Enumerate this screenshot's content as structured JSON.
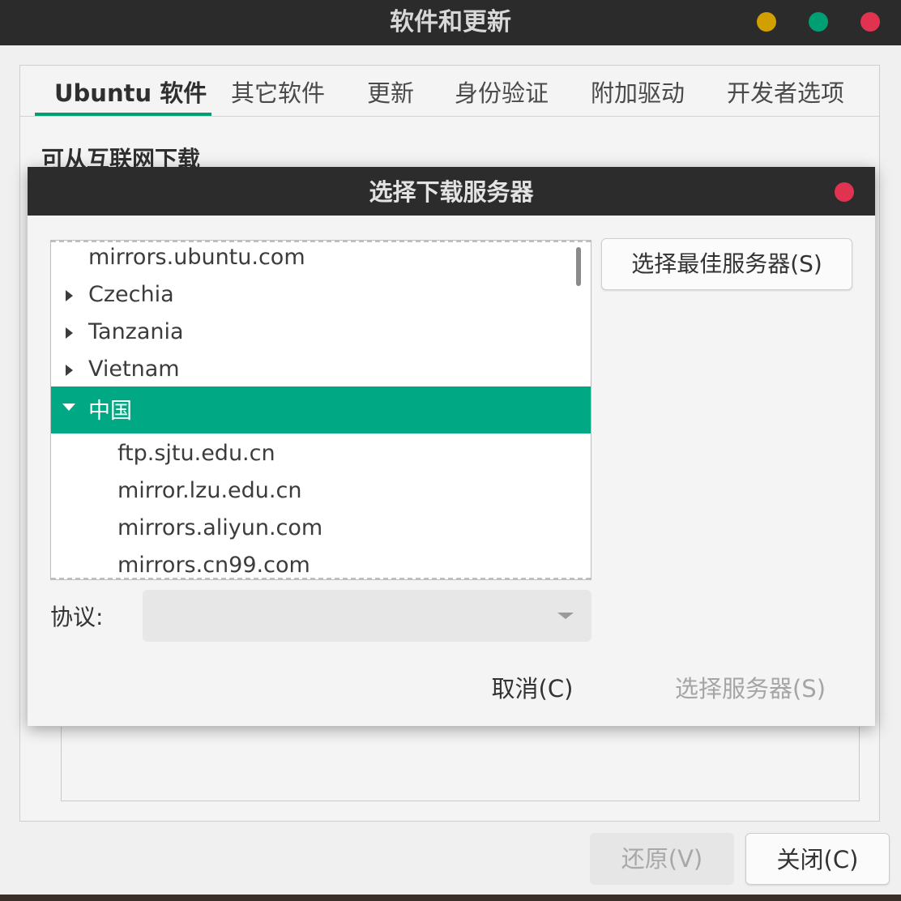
{
  "window": {
    "title": "软件和更新",
    "colors": {
      "minimize": "#d1a000",
      "maximize": "#009e73",
      "close": "#e0334f"
    }
  },
  "tabs": [
    {
      "label": "Ubuntu 软件",
      "active": true
    },
    {
      "label": "其它软件",
      "active": false
    },
    {
      "label": "更新",
      "active": false
    },
    {
      "label": "身份验证",
      "active": false
    },
    {
      "label": "附加驱动",
      "active": false
    },
    {
      "label": "开发者选项",
      "active": false
    }
  ],
  "section": {
    "heading": "可从互联网下载"
  },
  "bottom_buttons": {
    "revert": "还原(V)",
    "close": "关闭(C)"
  },
  "dialog": {
    "title": "选择下载服务器",
    "best_server_button": "选择最佳服务器(S)",
    "protocol_label": "协议:",
    "protocol_value": "",
    "cancel_button": "取消(C)",
    "choose_button": "选择服务器(S)",
    "accent_color": "#00a884",
    "server_list": [
      {
        "label": "mirrors.ubuntu.com",
        "level": 0,
        "expander": "none"
      },
      {
        "label": "Czechia",
        "level": 0,
        "expander": "collapsed"
      },
      {
        "label": "Tanzania",
        "level": 0,
        "expander": "collapsed"
      },
      {
        "label": "Vietnam",
        "level": 0,
        "expander": "collapsed"
      },
      {
        "label": "中国",
        "level": 0,
        "expander": "expanded",
        "selected": true
      },
      {
        "label": "ftp.sjtu.edu.cn",
        "level": 1,
        "expander": "none"
      },
      {
        "label": "mirror.lzu.edu.cn",
        "level": 1,
        "expander": "none"
      },
      {
        "label": "mirrors.aliyun.com",
        "level": 1,
        "expander": "none"
      },
      {
        "label": "mirrors.cn99.com",
        "level": 1,
        "expander": "none"
      }
    ]
  }
}
